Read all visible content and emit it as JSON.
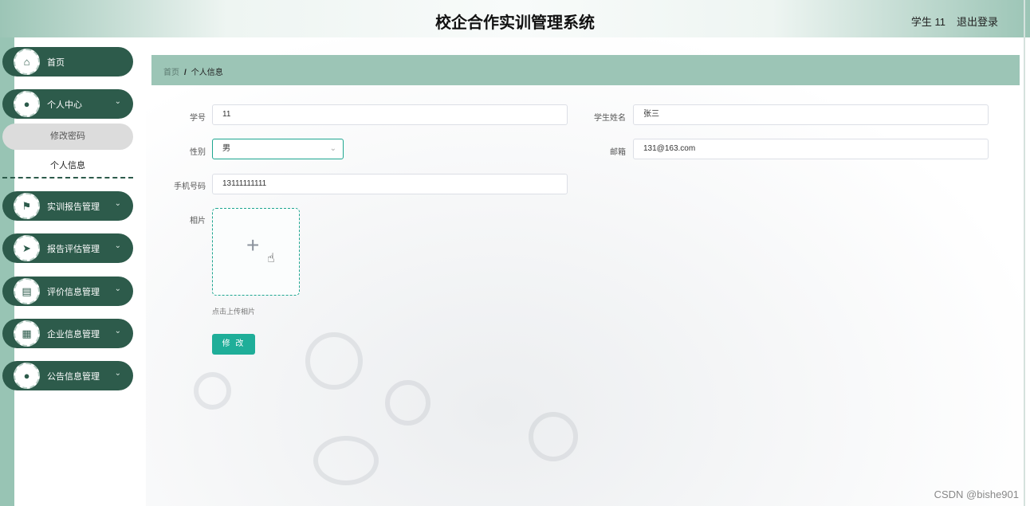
{
  "header": {
    "title": "校企合作实训管理系统",
    "user": "学生 11",
    "logout": "退出登录"
  },
  "sidebar": {
    "items": [
      {
        "label": "首页",
        "icon": "home-icon"
      },
      {
        "label": "个人中心",
        "icon": "user-icon"
      },
      {
        "label": "实训报告管理",
        "icon": "flag-icon"
      },
      {
        "label": "报告评估管理",
        "icon": "send-icon"
      },
      {
        "label": "评价信息管理",
        "icon": "chart-icon"
      },
      {
        "label": "企业信息管理",
        "icon": "grid-icon"
      },
      {
        "label": "公告信息管理",
        "icon": "user-icon"
      }
    ],
    "subitems": [
      {
        "label": "修改密码"
      },
      {
        "label": "个人信息"
      }
    ]
  },
  "breadcrumb": {
    "home": "首页",
    "separator": "/",
    "current": "个人信息"
  },
  "form": {
    "student_id": {
      "label": "学号",
      "value": "11"
    },
    "student_name": {
      "label": "学生姓名",
      "value": "张三"
    },
    "gender": {
      "label": "性别",
      "value": "男"
    },
    "email": {
      "label": "邮箱",
      "value": "131@163.com"
    },
    "phone": {
      "label": "手机号码",
      "value": "13111111111"
    },
    "photo": {
      "label": "相片",
      "tip": "点击上传相片"
    },
    "submit": "修 改"
  },
  "watermark": "CSDN @bishe901",
  "colors": {
    "accent": "#1fae99",
    "sidebar": "#2d5b4b",
    "breadcrumb_bg": "#9cc5b6"
  }
}
